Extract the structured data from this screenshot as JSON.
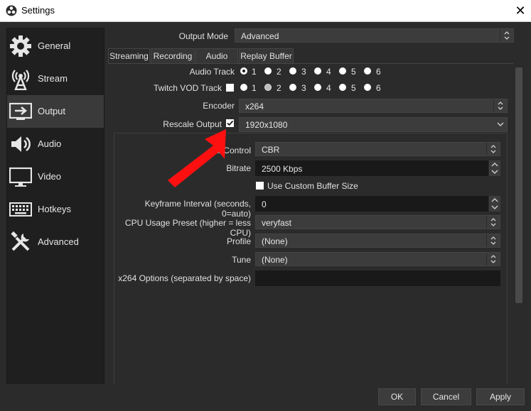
{
  "window": {
    "title": "Settings"
  },
  "sidebar": {
    "items": [
      {
        "label": "General",
        "icon": "gear-icon"
      },
      {
        "label": "Stream",
        "icon": "broadcast-icon"
      },
      {
        "label": "Output",
        "icon": "output-icon",
        "active": true
      },
      {
        "label": "Audio",
        "icon": "speaker-icon"
      },
      {
        "label": "Video",
        "icon": "monitor-icon"
      },
      {
        "label": "Hotkeys",
        "icon": "keyboard-icon"
      },
      {
        "label": "Advanced",
        "icon": "tools-icon"
      }
    ]
  },
  "output_mode": {
    "label": "Output Mode",
    "value": "Advanced"
  },
  "tabs": [
    "Streaming",
    "Recording",
    "Audio",
    "Replay Buffer"
  ],
  "active_tab": "Streaming",
  "audio_track": {
    "label": "Audio Track",
    "options": [
      "1",
      "2",
      "3",
      "4",
      "5",
      "6"
    ],
    "selected": "1"
  },
  "twitch_vod_track": {
    "label": "Twitch VOD Track",
    "checked": false,
    "options": [
      "1",
      "2",
      "3",
      "4",
      "5",
      "6"
    ],
    "selected": "2"
  },
  "encoder": {
    "label": "Encoder",
    "value": "x264"
  },
  "rescale_output": {
    "label": "Rescale Output",
    "checked": true,
    "value": "1920x1080"
  },
  "rate_control": {
    "label": "Rate Control",
    "visible_label": "te Control",
    "value": "CBR"
  },
  "bitrate": {
    "label": "Bitrate",
    "value": "2500 Kbps"
  },
  "custom_buffer": {
    "label": "Use Custom Buffer Size",
    "checked": false
  },
  "keyframe": {
    "label": "Keyframe Interval (seconds, 0=auto)",
    "value": "0"
  },
  "cpu_preset": {
    "label": "CPU Usage Preset (higher = less CPU)",
    "value": "veryfast"
  },
  "profile": {
    "label": "Profile",
    "value": "(None)"
  },
  "tune": {
    "label": "Tune",
    "value": "(None)"
  },
  "x264_options": {
    "label": "x264 Options (separated by space)",
    "value": ""
  },
  "buttons": {
    "ok": "OK",
    "cancel": "Cancel",
    "apply": "Apply"
  },
  "annotation": {
    "arrow_color": "#ff0000"
  },
  "colors": {
    "background": "#2b2b2b",
    "sidebar": "#1f1f1f",
    "input_dark": "#191919"
  }
}
